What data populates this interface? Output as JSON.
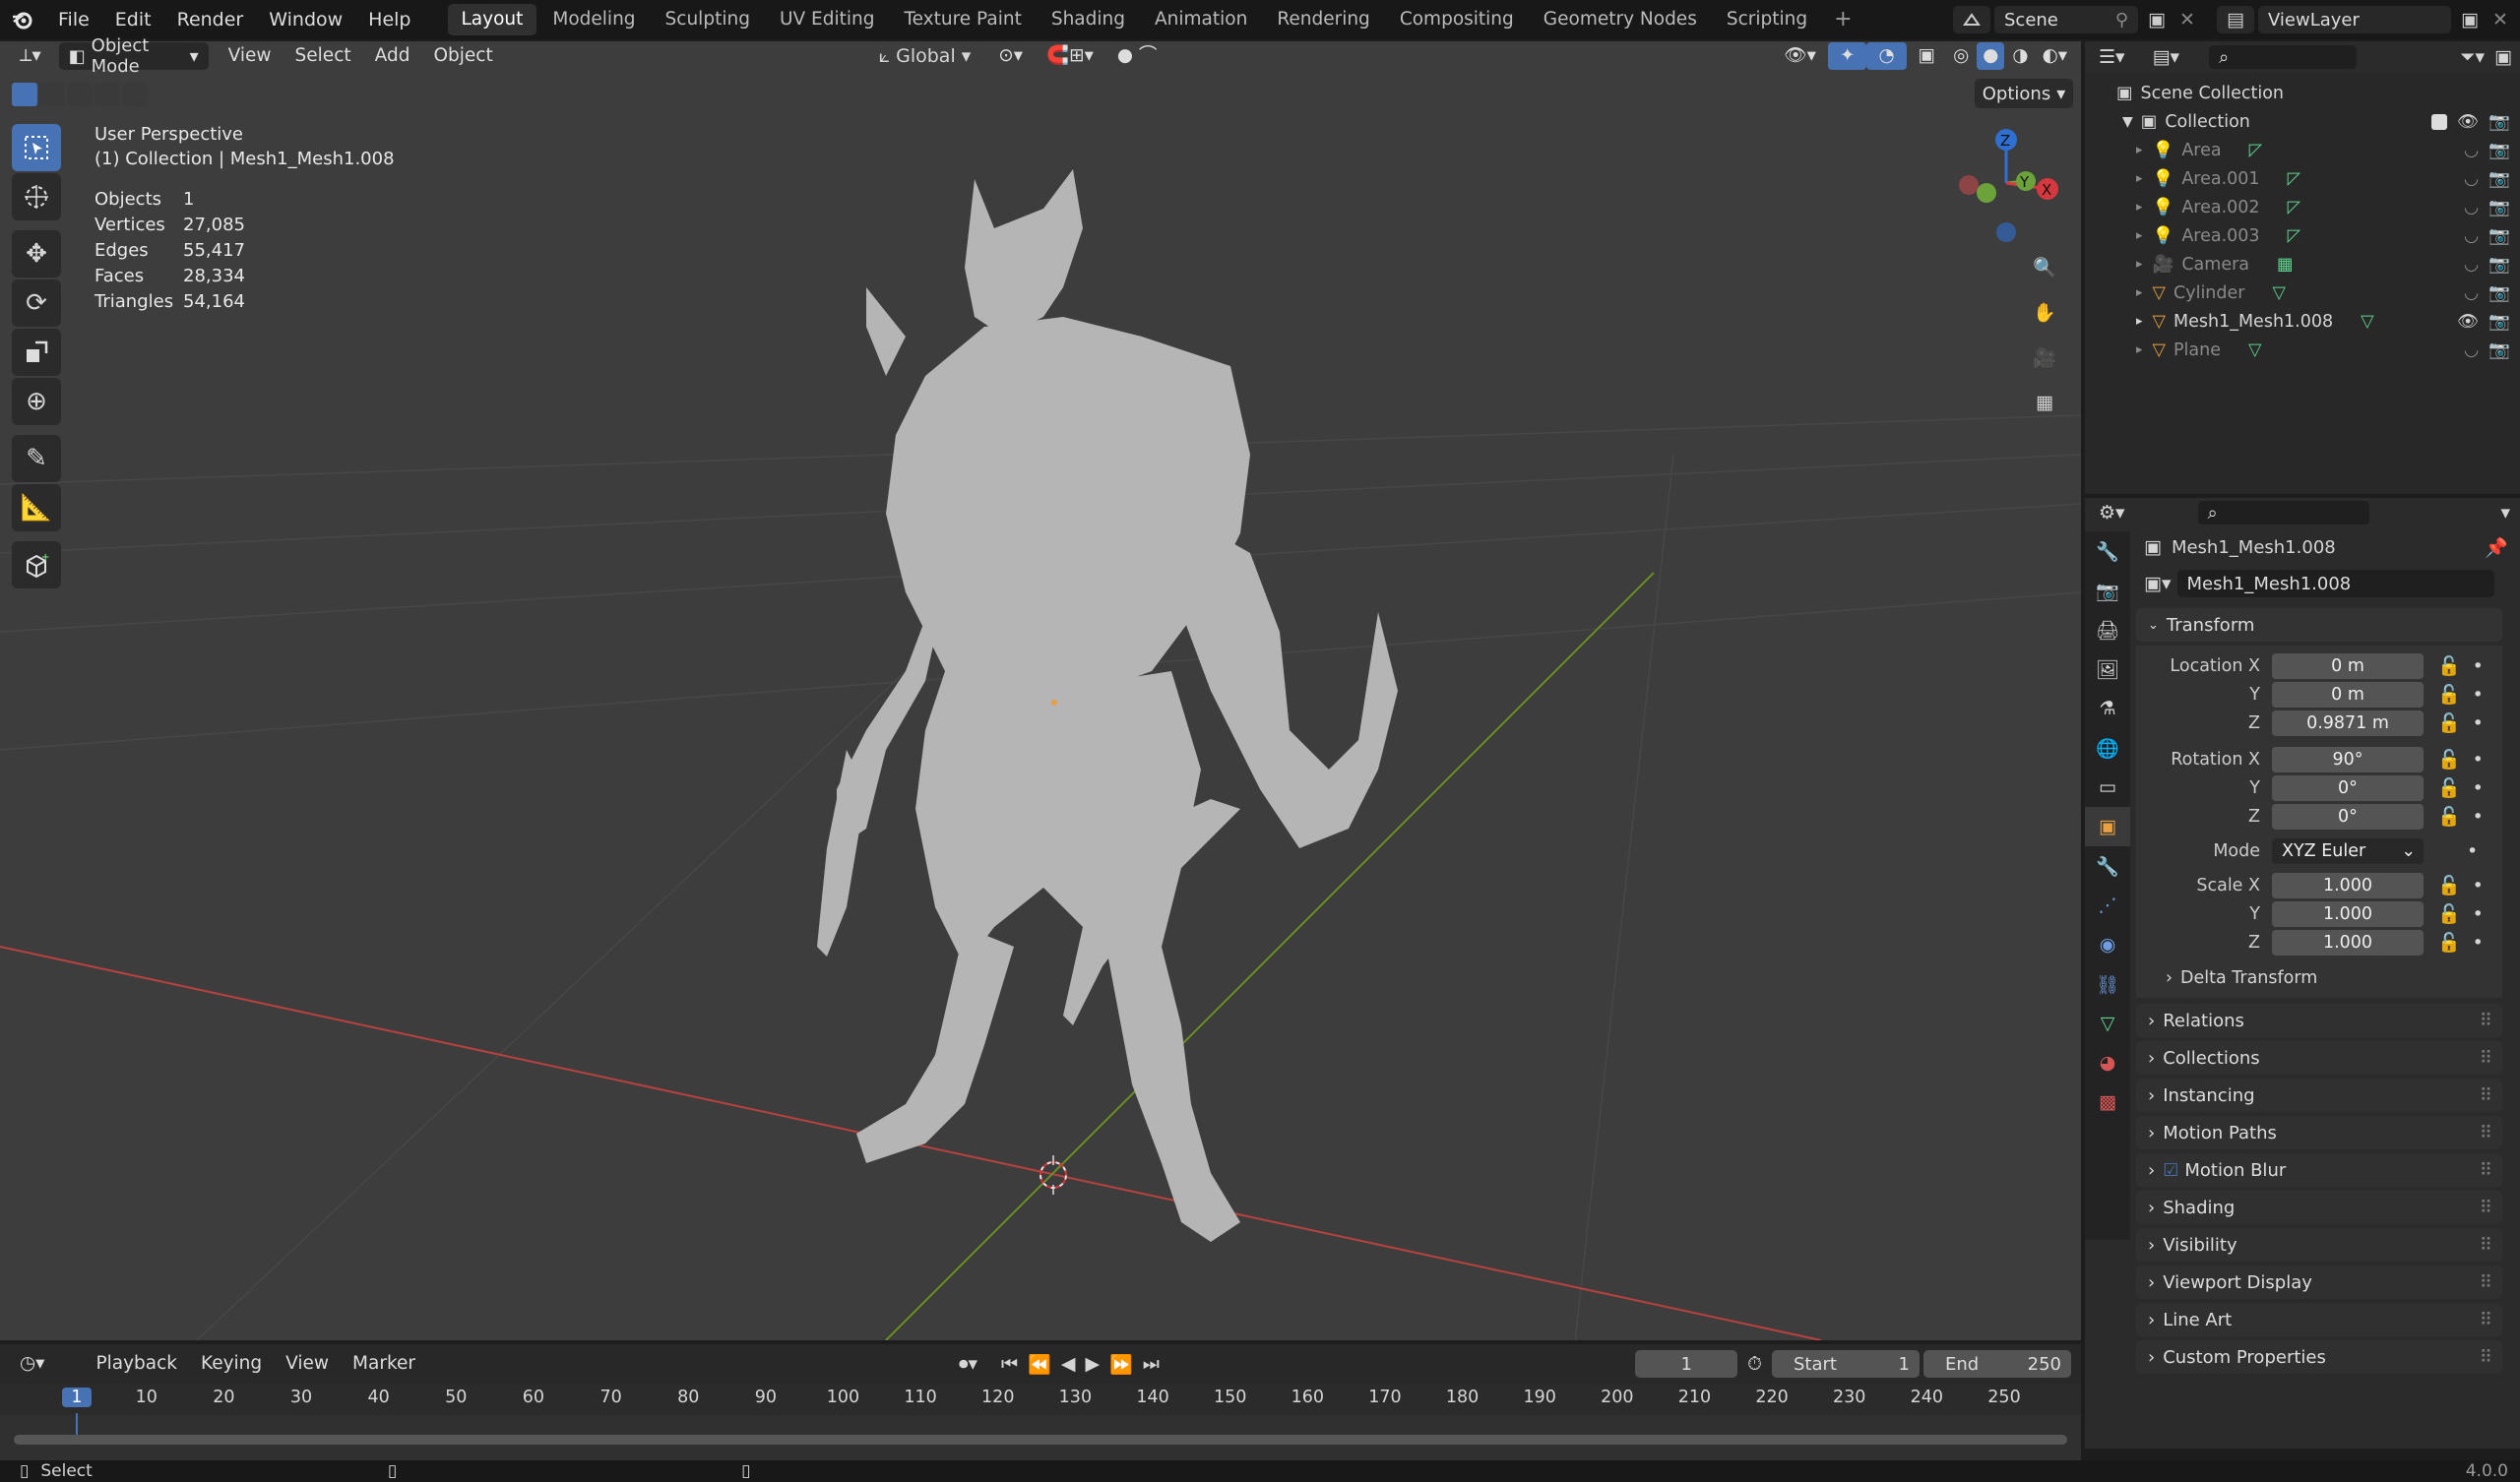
{
  "menu": {
    "items": [
      "File",
      "Edit",
      "Render",
      "Window",
      "Help"
    ]
  },
  "workspaces": [
    {
      "label": "Layout",
      "active": true
    },
    {
      "label": "Modeling"
    },
    {
      "label": "Sculpting"
    },
    {
      "label": "UV Editing"
    },
    {
      "label": "Texture Paint"
    },
    {
      "label": "Shading"
    },
    {
      "label": "Animation"
    },
    {
      "label": "Rendering"
    },
    {
      "label": "Compositing"
    },
    {
      "label": "Geometry Nodes"
    },
    {
      "label": "Scripting"
    }
  ],
  "scene": {
    "name": "Scene",
    "view_layer": "ViewLayer"
  },
  "viewport": {
    "mode": "Object Mode",
    "menus": [
      "View",
      "Select",
      "Add",
      "Object"
    ],
    "transform_orientation": "Global",
    "options_label": "Options",
    "overlay_title": "User Perspective",
    "overlay_subtitle": "(1) Collection | Mesh1_Mesh1.008",
    "stats": [
      {
        "k": "Objects",
        "v": "1"
      },
      {
        "k": "Vertices",
        "v": "27,085"
      },
      {
        "k": "Edges",
        "v": "55,417"
      },
      {
        "k": "Faces",
        "v": "28,334"
      },
      {
        "k": "Triangles",
        "v": "54,164"
      }
    ],
    "gizmo": {
      "z": "Z",
      "y": "Y",
      "x": "X"
    },
    "colors": {
      "bg": "#3d3d3d",
      "grid": "#474747",
      "x_axis": "#b8423f",
      "y_axis": "#6b8e23",
      "mesh": "#b8b8b8",
      "active": "#4772b3"
    }
  },
  "outliner": {
    "root": "Scene Collection",
    "collection": "Collection",
    "items": [
      {
        "name": "Area",
        "type": "light",
        "dim": true
      },
      {
        "name": "Area.001",
        "type": "light",
        "dim": true
      },
      {
        "name": "Area.002",
        "type": "light",
        "dim": true
      },
      {
        "name": "Area.003",
        "type": "light",
        "dim": true
      },
      {
        "name": "Camera",
        "type": "camera",
        "dim": true
      },
      {
        "name": "Cylinder",
        "type": "mesh",
        "dim": true
      },
      {
        "name": "Mesh1_Mesh1.008",
        "type": "mesh",
        "dim": false
      },
      {
        "name": "Plane",
        "type": "mesh",
        "dim": true
      }
    ]
  },
  "properties": {
    "object_name": "Mesh1_Mesh1.008",
    "data_name": "Mesh1_Mesh1.008",
    "transform": {
      "title": "Transform",
      "location_label": "Location X",
      "location": [
        "0 m",
        "0 m",
        "0.9871 m"
      ],
      "rotation_label": "Rotation X",
      "rotation": [
        "90°",
        "0°",
        "0°"
      ],
      "mode_label": "Mode",
      "mode": "XYZ Euler",
      "scale_label": "Scale X",
      "scale": [
        "1.000",
        "1.000",
        "1.000"
      ],
      "y": "Y",
      "z": "Z",
      "delta": "Delta Transform"
    },
    "panels": [
      "Relations",
      "Collections",
      "Instancing",
      "Motion Paths",
      "Motion Blur",
      "Shading",
      "Visibility",
      "Viewport Display",
      "Line Art",
      "Custom Properties"
    ]
  },
  "timeline": {
    "menus": [
      "Playback",
      "Keying",
      "View",
      "Marker"
    ],
    "current_frame": "1",
    "start_label": "Start",
    "start": "1",
    "end_label": "End",
    "end": "250",
    "ticks": [
      "1",
      "10",
      "20",
      "30",
      "40",
      "50",
      "60",
      "70",
      "80",
      "90",
      "100",
      "110",
      "120",
      "130",
      "140",
      "150",
      "160",
      "170",
      "180",
      "190",
      "200",
      "210",
      "220",
      "230",
      "240",
      "250"
    ]
  },
  "status": {
    "left": "Select",
    "version": "4.0.0"
  }
}
